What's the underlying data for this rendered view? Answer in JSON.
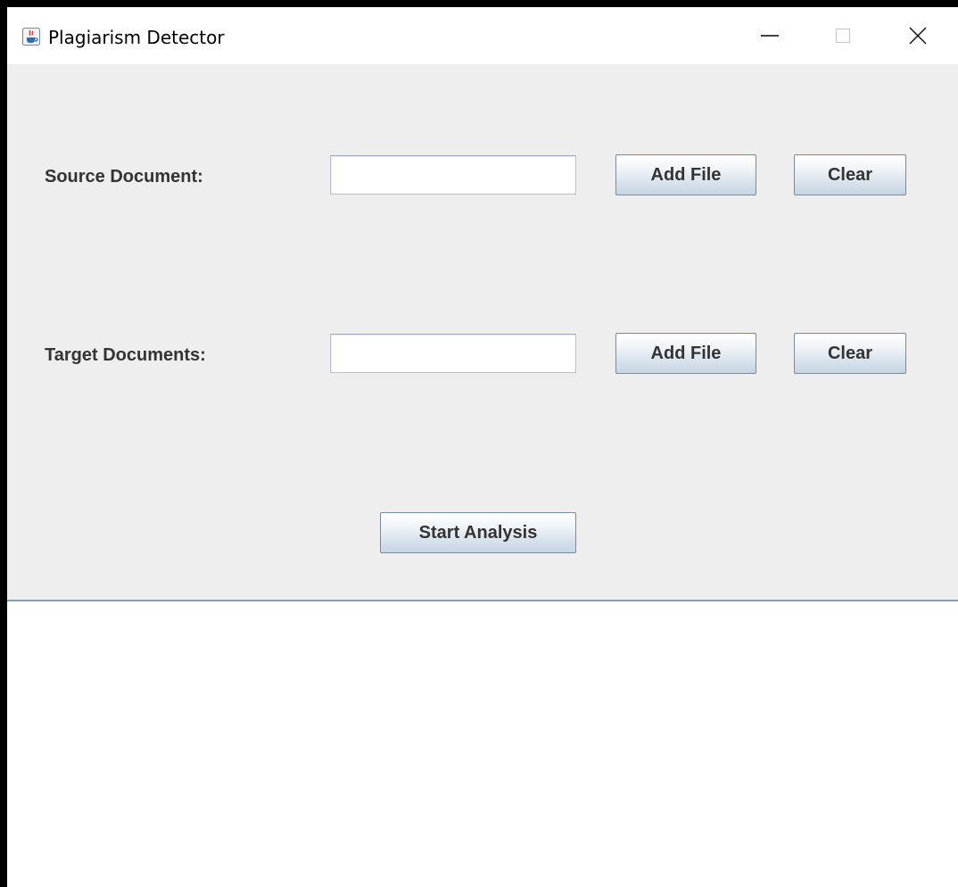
{
  "window": {
    "title": "Plagiarism Detector",
    "icon": "java-coffee-cup-icon",
    "controls": [
      "minimize-icon",
      "maximize-icon",
      "close-icon"
    ]
  },
  "form": {
    "source": {
      "label": "Source Document:",
      "value": "",
      "add_label": "Add File",
      "clear_label": "Clear"
    },
    "target": {
      "label": "Target Documents:",
      "value": "",
      "add_label": "Add File",
      "clear_label": "Clear"
    },
    "start_label": "Start Analysis"
  },
  "colors": {
    "panel_background": "#eeeeee",
    "results_background": "#ffffff",
    "button_gradient_bottom": "#c7d6e4",
    "text": "#333333"
  }
}
